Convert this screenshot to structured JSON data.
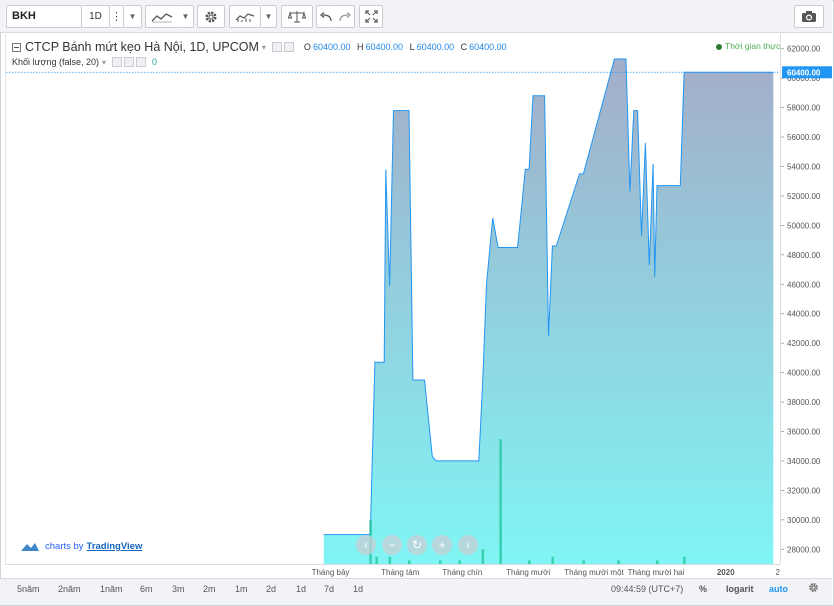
{
  "toolbar": {
    "symbol": "BKH",
    "interval": "1D",
    "icons": [
      "more-vertical-icon",
      "caret-down-icon",
      "chart-style-icon",
      "caret-down-icon",
      "settings-gear-icon",
      "indicators-icon",
      "caret-down-icon",
      "compare-scale-icon",
      "undo-icon",
      "redo-icon",
      "fullscreen-icon",
      "camera-icon"
    ]
  },
  "legend": {
    "title": "CTCP Bánh mứt kẹo Hà Nội, 1D, UPCOM",
    "o_label": "O",
    "o": "60400.00",
    "h_label": "H",
    "h": "60400.00",
    "l_label": "L",
    "l": "60400.00",
    "c_label": "C",
    "c": "60400.00",
    "volume_label": "Khối lượng (false, 20)",
    "volume_value": "0"
  },
  "realtime_label": "Thời gian thực",
  "branding": {
    "prefix": "charts by",
    "name": "TradingView"
  },
  "bottom_bar": {
    "ranges": [
      "5năm",
      "2năm",
      "1năm",
      "6m",
      "3m",
      "2m",
      "1m",
      "2d",
      "1d",
      "7d",
      "1d"
    ],
    "clock": "09:44:59 (UTC+7)",
    "percent": "%",
    "log": "logarit",
    "auto": "auto"
  },
  "colors": {
    "line": "#2196f3",
    "area_top": "#9fb0cc",
    "area_bottom": "#7ff4f4",
    "volume": "#26c6a0",
    "last_price_bg": "#2196f3",
    "accent": "#2962ff"
  },
  "chart_data": {
    "type": "area",
    "ylim": [
      27000,
      63000
    ],
    "ytick_labels": [
      "62000.00",
      "60000.00",
      "58000.00",
      "56000.00",
      "54000.00",
      "52000.00",
      "50000.00",
      "48000.00",
      "46000.00",
      "44000.00",
      "42000.00",
      "40000.00",
      "38000.00",
      "36000.00",
      "34000.00",
      "32000.00",
      "30000.00",
      "28000.00"
    ],
    "yticks": [
      62000,
      60000,
      58000,
      56000,
      54000,
      52000,
      50000,
      48000,
      46000,
      44000,
      42000,
      40000,
      38000,
      36000,
      34000,
      32000,
      30000,
      28000
    ],
    "last_price": 60400,
    "last_price_label": "60400.00",
    "xtick_labels": [
      "Tháng bảy",
      "Tháng tám",
      "Tháng chín",
      "Tháng mười",
      "Tháng mười một",
      "Tháng mười hai",
      "2020",
      "2"
    ],
    "xtick_pos": [
      0.42,
      0.51,
      0.59,
      0.675,
      0.76,
      0.84,
      0.93,
      1.0
    ],
    "series": [
      {
        "name": "BKH",
        "x": [
          0.41,
          0.47,
          0.476,
          0.478,
          0.488,
          0.49,
          0.495,
          0.5,
          0.505,
          0.508,
          0.52,
          0.525,
          0.54,
          0.55,
          0.555,
          0.56,
          0.61,
          0.615,
          0.62,
          0.628,
          0.635,
          0.64,
          0.66,
          0.663,
          0.67,
          0.675,
          0.68,
          0.69,
          0.695,
          0.7,
          0.705,
          0.71,
          0.74,
          0.745,
          0.785,
          0.79,
          0.795,
          0.8,
          0.805,
          0.81,
          0.815,
          0.82,
          0.825,
          0.83,
          0.835,
          0.837,
          0.84,
          0.845,
          0.85,
          0.87,
          0.875,
          0.99
        ],
        "values": [
          29000,
          29000,
          40700,
          40700,
          40700,
          53800,
          45900,
          57800,
          57800,
          57800,
          57800,
          39500,
          39500,
          34300,
          34000,
          34000,
          34000,
          39200,
          46000,
          50500,
          48500,
          48500,
          48500,
          50000,
          53800,
          53800,
          58800,
          58800,
          58800,
          42500,
          48600,
          48600,
          53500,
          53500,
          61300,
          61300,
          61300,
          61300,
          52300,
          57800,
          57800,
          49300,
          55600,
          47300,
          54200,
          46500,
          52700,
          52700,
          52700,
          52700,
          60400,
          60400
        ]
      }
    ],
    "volume": {
      "x": [
        0.47,
        0.478,
        0.495,
        0.52,
        0.56,
        0.585,
        0.615,
        0.638,
        0.675,
        0.705,
        0.745,
        0.79,
        0.84,
        0.875
      ],
      "values": [
        0.12,
        0.02,
        0.02,
        0.01,
        0.01,
        0.01,
        0.04,
        0.34,
        0.01,
        0.02,
        0.01,
        0.01,
        0.01,
        0.02
      ]
    },
    "grid": false
  }
}
